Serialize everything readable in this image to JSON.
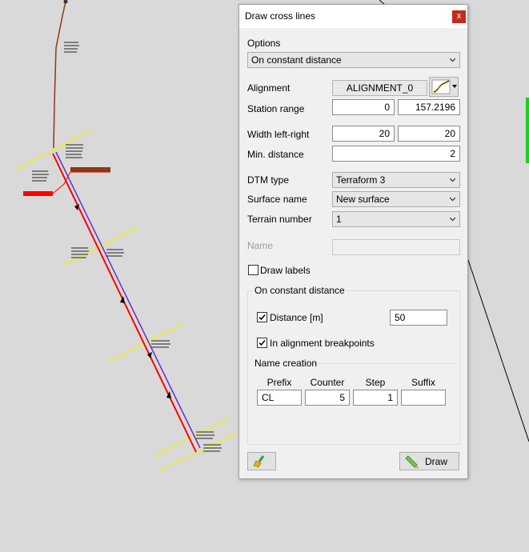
{
  "dialog": {
    "title": "Draw cross lines",
    "options_label": "Options",
    "options_value": "On constant distance",
    "alignment_label": "Alignment",
    "alignment_value": "ALIGNMENT_0",
    "station_range_label": "Station range",
    "station_from": "0",
    "station_to": "157.2196",
    "width_label": "Width left-right",
    "width_left": "20",
    "width_right": "20",
    "min_distance_label": "Min. distance",
    "min_distance": "2",
    "dtm_type_label": "DTM type",
    "dtm_type_value": "Terraform 3",
    "surface_name_label": "Surface name",
    "surface_name_value": "New surface",
    "terrain_number_label": "Terrain number",
    "terrain_number_value": "1",
    "name_label": "Name",
    "name_value": "",
    "draw_labels_label": "Draw labels",
    "draw_labels_checked": false,
    "group_title": "On constant distance",
    "distance_label": "Distance [m]",
    "distance_checked": true,
    "distance_value": "50",
    "breakpoints_label": "In alignment breakpoints",
    "breakpoints_checked": true,
    "name_creation_title": "Name creation",
    "columns": [
      "Prefix",
      "Counter",
      "Step",
      "Suffix"
    ],
    "prefix": "CL",
    "counter": "5",
    "step": "1",
    "suffix": "",
    "draw_button": "Draw",
    "close_glyph": "x"
  },
  "colors": {
    "alignment_red": "#ff0000",
    "offset_blue": "#6a2cc8",
    "cross_line_yellow": "#f2f200",
    "terrain_brown": "#8b3a0f",
    "green_edge": "#22cc22",
    "close_red": "#c42b1c"
  }
}
